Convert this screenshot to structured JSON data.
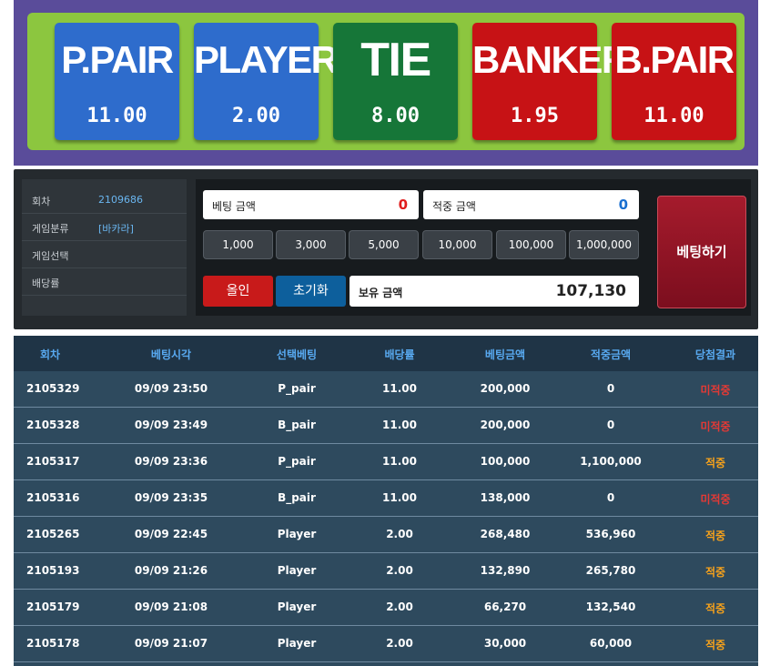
{
  "bets": [
    {
      "name": "P.PAIR",
      "odds": "11.00",
      "color": "#2e6ccc"
    },
    {
      "name": "PLAYER",
      "odds": "2.00",
      "color": "#2e6ccc"
    },
    {
      "name": "TIE",
      "odds": "8.00",
      "color": "#167638"
    },
    {
      "name": "BANKER",
      "odds": "1.95",
      "color": "#c71215"
    },
    {
      "name": "B.PAIR",
      "odds": "11.00",
      "color": "#c71215"
    }
  ],
  "info": {
    "round_label": "회차",
    "round_value": "2109686",
    "category_label": "게임분류",
    "category_value": "[바카라]",
    "select_label": "게임선택",
    "select_value": "",
    "odds_label": "배당률",
    "odds_value": ""
  },
  "controls": {
    "bet_amount_label": "베팅 금액",
    "bet_amount_value": "0",
    "win_amount_label": "적중 금액",
    "win_amount_value": "0",
    "chips": [
      "1,000",
      "3,000",
      "5,000",
      "10,000",
      "100,000",
      "1,000,000"
    ],
    "all_in_label": "올인",
    "reset_label": "초기화",
    "holding_label": "보유 금액",
    "holding_value": "107,130",
    "place_bet_label": "베팅하기"
  },
  "history": {
    "columns": [
      "회차",
      "베팅시각",
      "선택베팅",
      "배당률",
      "베팅금액",
      "적중금액",
      "당첨결과"
    ],
    "rows": [
      [
        "2105329",
        "09/09 23:50",
        "P_pair",
        "11.00",
        "200,000",
        "0",
        "미적중"
      ],
      [
        "2105328",
        "09/09 23:49",
        "B_pair",
        "11.00",
        "200,000",
        "0",
        "미적중"
      ],
      [
        "2105317",
        "09/09 23:36",
        "P_pair",
        "11.00",
        "100,000",
        "1,100,000",
        "적중"
      ],
      [
        "2105316",
        "09/09 23:35",
        "B_pair",
        "11.00",
        "138,000",
        "0",
        "미적중"
      ],
      [
        "2105265",
        "09/09 22:45",
        "Player",
        "2.00",
        "268,480",
        "536,960",
        "적중"
      ],
      [
        "2105193",
        "09/09 21:26",
        "Player",
        "2.00",
        "132,890",
        "265,780",
        "적중"
      ],
      [
        "2105179",
        "09/09 21:08",
        "Player",
        "2.00",
        "66,270",
        "132,540",
        "적중"
      ],
      [
        "2105178",
        "09/09 21:07",
        "Player",
        "2.00",
        "30,000",
        "60,000",
        "적중"
      ]
    ]
  }
}
